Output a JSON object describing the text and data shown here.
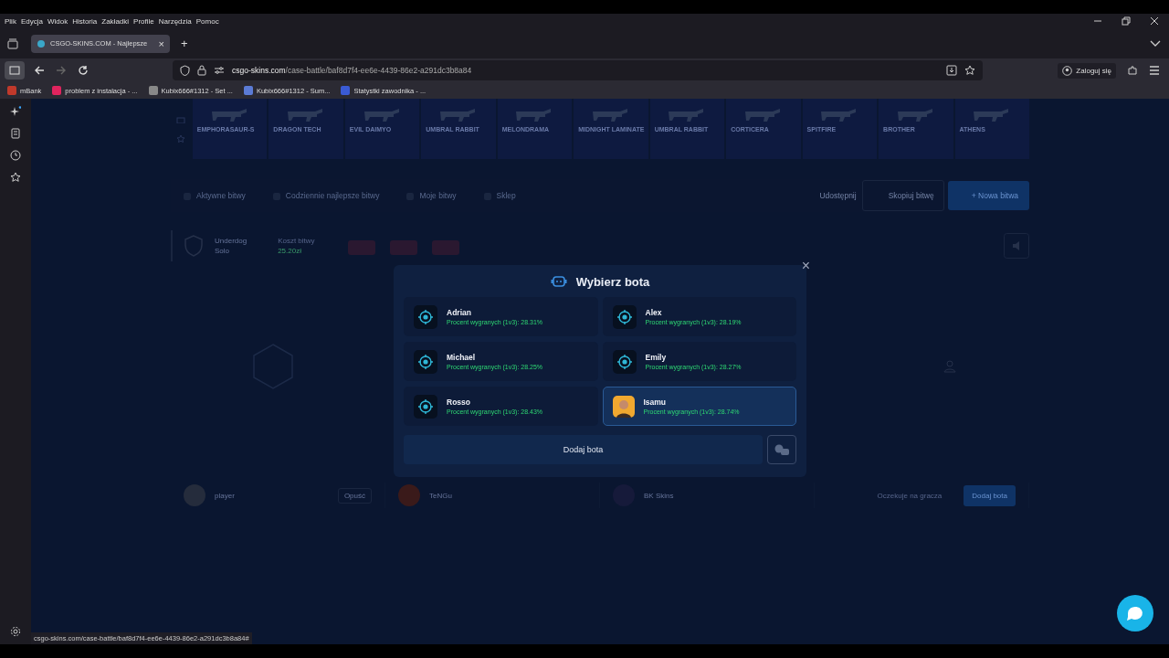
{
  "browser": {
    "menu": [
      "Plik",
      "Edycja",
      "Widok",
      "Historia",
      "Zakładki",
      "Profile",
      "Narzędzia",
      "Pomoc"
    ],
    "tab": {
      "title": "CSGO-SKINS.COM - Najlepsze",
      "close": "×",
      "new_tab": "+"
    },
    "url": {
      "host": "csgo-skins.com",
      "path": "/case-battle/baf8d7f4-ee6e-4439-86e2-a291dc3b8a84"
    },
    "login": "Zaloguj się",
    "bookmarks": [
      "mBank",
      "problem z instalacja - ...",
      "Kubix666#1312 - Set ...",
      "Kubix666#1312 - Sum...",
      "Statystki zawodnika - ..."
    ],
    "status_url": "csgo-skins.com/case-battle/baf8d7f4-ee6e-4439-86e2-a291dc3b8a84#"
  },
  "page": {
    "skins": [
      {
        "name": "EMPHORASAUR-S"
      },
      {
        "name": "DRAGON TECH"
      },
      {
        "name": "EVIL DAIMYO"
      },
      {
        "name": "UMBRAL RABBIT"
      },
      {
        "name": "MELONDRAMA"
      },
      {
        "name": "MIDNIGHT LAMINATE"
      },
      {
        "name": "UMBRAL RABBIT"
      },
      {
        "name": "CORTICERA"
      },
      {
        "name": "SPITFIRE"
      },
      {
        "name": "BROTHER"
      },
      {
        "name": "ATHENS"
      }
    ],
    "nav_tabs": [
      {
        "label": "Aktywne bitwy",
        "selected": false
      },
      {
        "label": "Codziennie najlepsze bitwy",
        "selected": false
      },
      {
        "label": "Moje bitwy",
        "selected": false
      },
      {
        "label": "Sklep",
        "selected": false
      }
    ],
    "share": "Udostępnij",
    "copy": "Skopiuj bitwę",
    "new_battle": "+ Nowa bitwa",
    "battle": {
      "mode": "Underdog",
      "type": "Solo",
      "cost_label": "Koszt bitwy",
      "cost": "25.20zł"
    },
    "players": [
      {
        "name": "player",
        "action": "Opuść",
        "kind": "player"
      },
      {
        "name": "TeNGu",
        "kind": "player"
      },
      {
        "name": "BK Skins",
        "kind": "player"
      },
      {
        "status": "Oczekuje na gracza",
        "action": "Dodaj bota",
        "kind": "empty"
      }
    ],
    "modal": {
      "title": "Wybierz bota",
      "close": "×",
      "add_button": "Dodaj bota",
      "bots": [
        {
          "name": "Adrian",
          "stat": "Procent wygranych (1v3): 28.31%",
          "kind": "target",
          "selected": false
        },
        {
          "name": "Alex",
          "stat": "Procent wygranych (1v3): 28.19%",
          "kind": "target",
          "selected": false
        },
        {
          "name": "Michael",
          "stat": "Procent wygranych (1v3): 28.25%",
          "kind": "target",
          "selected": false
        },
        {
          "name": "Emily",
          "stat": "Procent wygranych (1v3): 28.27%",
          "kind": "target",
          "selected": false
        },
        {
          "name": "Rosso",
          "stat": "Procent wygranych (1v3): 28.43%",
          "kind": "target",
          "selected": false
        },
        {
          "name": "Isamu",
          "stat": "Procent wygranych (1v3): 28.74%",
          "kind": "avatar",
          "selected": true
        }
      ]
    }
  }
}
